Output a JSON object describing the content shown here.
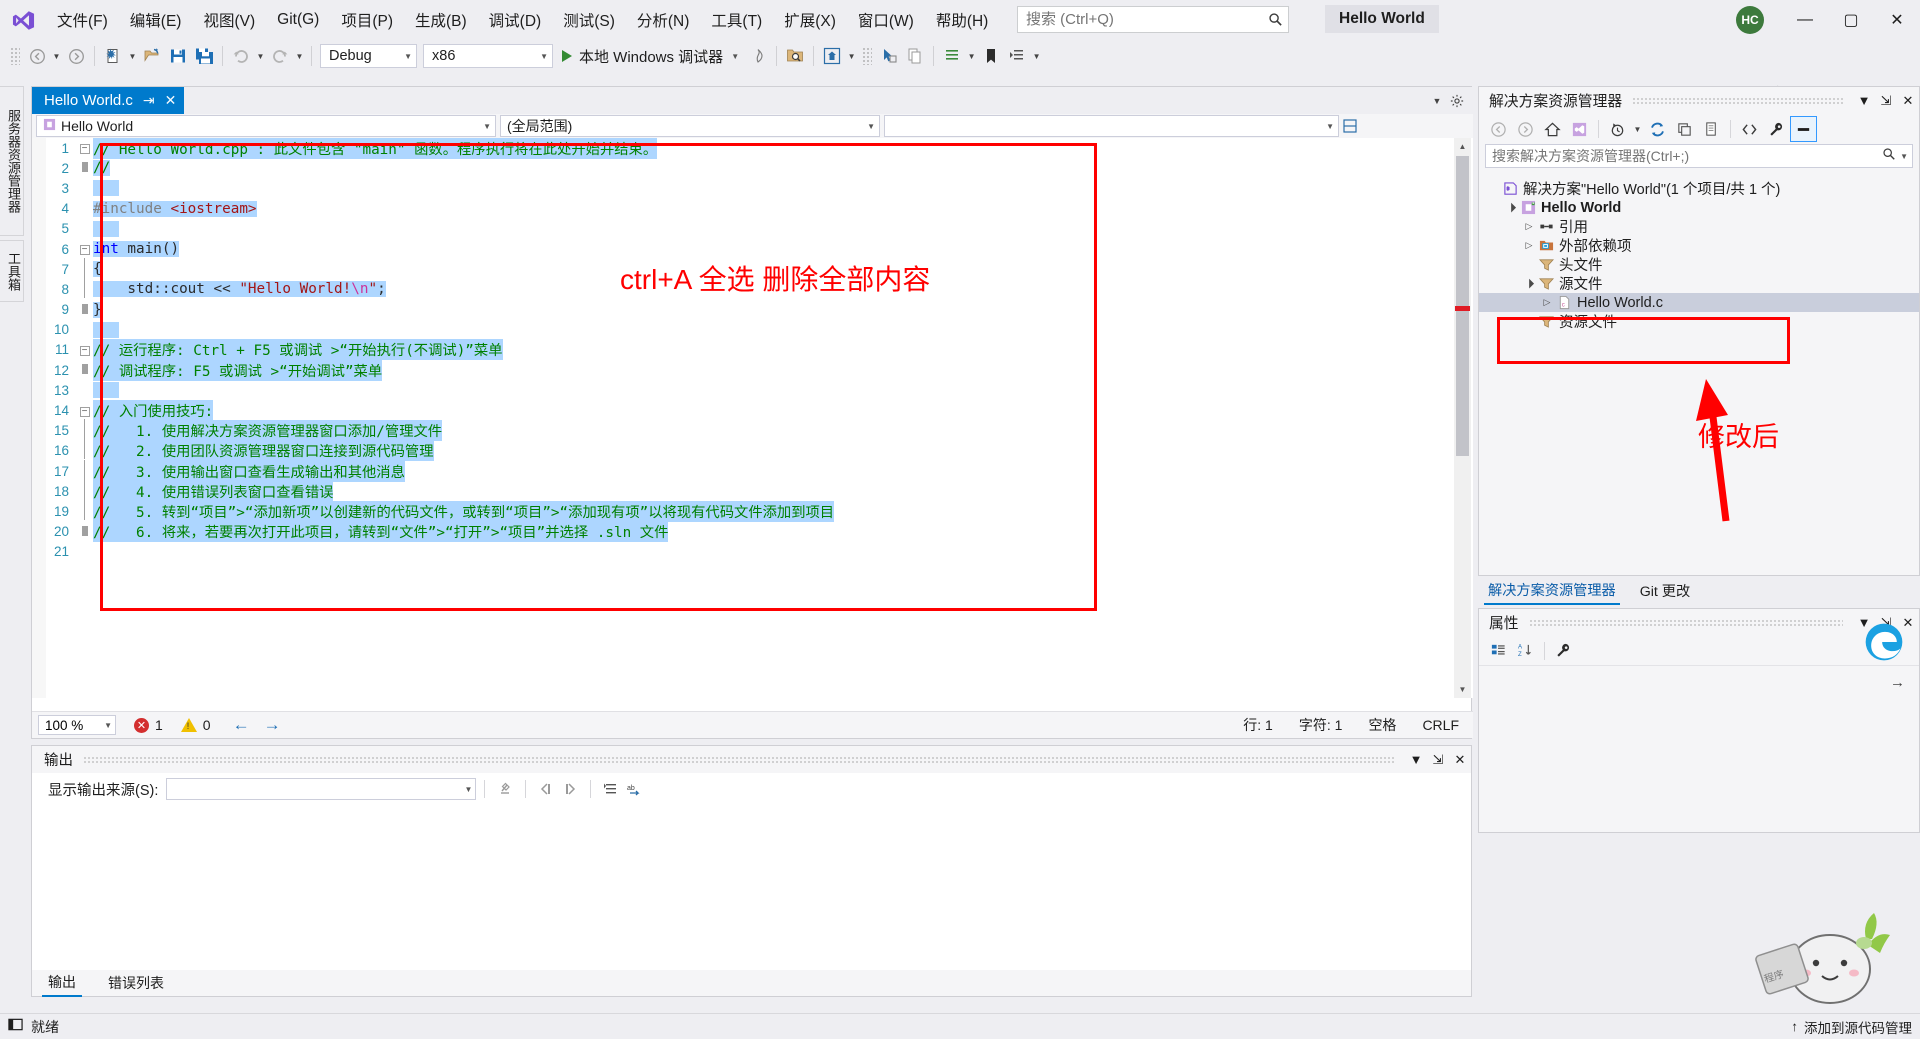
{
  "app": {
    "window_title": "Hello World",
    "solution_name_badge": "Hello World",
    "avatar_initials": "HC"
  },
  "menu": {
    "items": [
      {
        "label": "文件(F)"
      },
      {
        "label": "编辑(E)"
      },
      {
        "label": "视图(V)"
      },
      {
        "label": "Git(G)"
      },
      {
        "label": "项目(P)"
      },
      {
        "label": "生成(B)"
      },
      {
        "label": "调试(D)"
      },
      {
        "label": "测试(S)"
      },
      {
        "label": "分析(N)"
      },
      {
        "label": "工具(T)"
      },
      {
        "label": "扩展(X)"
      },
      {
        "label": "窗口(W)"
      },
      {
        "label": "帮助(H)"
      }
    ]
  },
  "search": {
    "placeholder": "搜索 (Ctrl+Q)",
    "value": ""
  },
  "window_controls": {
    "minimize": "—",
    "maximize": "▢",
    "close": "✕"
  },
  "toolbar": {
    "configuration": "Debug",
    "platform": "x86",
    "run_label": "本地 Windows 调试器",
    "live_share": "Live Share"
  },
  "vertical_tabs": {
    "server_explorer": "服务器资源管理器",
    "toolbox": "工具箱"
  },
  "editor": {
    "tab_label": "Hello World.c",
    "nav_left": "Hello World",
    "nav_middle": "(全局范围)",
    "nav_right": "",
    "zoom": "100 %",
    "error_count": "1",
    "warning_count": "0",
    "status_line": "行: 1",
    "status_col": "字符: 1",
    "status_mode": "空格",
    "status_eol": "CRLF",
    "lines": [
      {
        "n": "1",
        "fold": "minus",
        "text": "// Hello World.cpp : 此文件包含 \"main\" 函数。程序执行将在此处开始并结束。",
        "type": "comment",
        "selected": true
      },
      {
        "n": "2",
        "fold": "end",
        "text": "//",
        "type": "comment",
        "selected": true
      },
      {
        "n": "3",
        "fold": "none",
        "text": "",
        "type": "blank",
        "selected": true
      },
      {
        "n": "4",
        "fold": "none",
        "text": "#include <iostream>",
        "type": "include",
        "selected": true
      },
      {
        "n": "5",
        "fold": "none",
        "text": "",
        "type": "blank",
        "selected": true
      },
      {
        "n": "6",
        "fold": "minus",
        "text": "int main()",
        "type": "func",
        "selected": true
      },
      {
        "n": "7",
        "fold": "bar",
        "text": "{",
        "type": "plain",
        "selected": true
      },
      {
        "n": "8",
        "fold": "bar",
        "text": "    std::cout << \"Hello World!\\n\";",
        "type": "cout",
        "selected": true
      },
      {
        "n": "9",
        "fold": "end",
        "text": "}",
        "type": "plain",
        "selected": true
      },
      {
        "n": "10",
        "fold": "none",
        "text": "",
        "type": "blank",
        "selected": true
      },
      {
        "n": "11",
        "fold": "minus",
        "text": "// 运行程序: Ctrl + F5 或调试 >“开始执行(不调试)”菜单",
        "type": "comment",
        "selected": true
      },
      {
        "n": "12",
        "fold": "end",
        "text": "// 调试程序: F5 或调试 >“开始调试”菜单",
        "type": "comment",
        "selected": true
      },
      {
        "n": "13",
        "fold": "none",
        "text": "",
        "type": "blank",
        "selected": true
      },
      {
        "n": "14",
        "fold": "minus",
        "text": "// 入门使用技巧:",
        "type": "comment",
        "selected": true
      },
      {
        "n": "15",
        "fold": "bar",
        "text": "//   1. 使用解决方案资源管理器窗口添加/管理文件",
        "type": "comment",
        "selected": true
      },
      {
        "n": "16",
        "fold": "bar",
        "text": "//   2. 使用团队资源管理器窗口连接到源代码管理",
        "type": "comment",
        "selected": true
      },
      {
        "n": "17",
        "fold": "bar",
        "text": "//   3. 使用输出窗口查看生成输出和其他消息",
        "type": "comment",
        "selected": true
      },
      {
        "n": "18",
        "fold": "bar",
        "text": "//   4. 使用错误列表窗口查看错误",
        "type": "comment",
        "selected": true
      },
      {
        "n": "19",
        "fold": "bar",
        "text": "//   5. 转到“项目”>“添加新项”以创建新的代码文件，或转到“项目”>“添加现有项”以将现有代码文件添加到项目",
        "type": "comment",
        "selected": true
      },
      {
        "n": "20",
        "fold": "end",
        "text": "//   6. 将来，若要再次打开此项目，请转到“文件”>“打开”>“项目”并选择 .sln 文件",
        "type": "comment",
        "selected": true
      },
      {
        "n": "21",
        "fold": "none",
        "text": "",
        "type": "blank",
        "selected": false
      }
    ]
  },
  "output": {
    "title": "输出",
    "source_label": "显示输出来源(S):",
    "source_value": "",
    "body_text": "",
    "tabs": [
      {
        "label": "输出",
        "active": true
      },
      {
        "label": "错误列表",
        "active": false
      }
    ]
  },
  "solution_explorer": {
    "title": "解决方案资源管理器",
    "search_placeholder": "搜索解决方案资源管理器(Ctrl+;)",
    "tree": [
      {
        "label": "解决方案\"Hello World\"(1 个项目/共 1 个)",
        "indent": 0,
        "expander": "",
        "icon": "solution-icon",
        "bold": false,
        "selected": false
      },
      {
        "label": "Hello World",
        "indent": 1,
        "expander": "▲",
        "icon": "project-icon",
        "bold": true,
        "selected": false
      },
      {
        "label": "引用",
        "indent": 2,
        "expander": "▷",
        "icon": "references-icon",
        "bold": false,
        "selected": false
      },
      {
        "label": "外部依赖项",
        "indent": 2,
        "expander": "▷",
        "icon": "dependencies-icon",
        "bold": false,
        "selected": false
      },
      {
        "label": "头文件",
        "indent": 2,
        "expander": "",
        "icon": "filter-folder-icon",
        "bold": false,
        "selected": false
      },
      {
        "label": "源文件",
        "indent": 2,
        "expander": "▲",
        "icon": "filter-folder-icon",
        "bold": false,
        "selected": false
      },
      {
        "label": "Hello World.c",
        "indent": 3,
        "expander": "▷",
        "icon": "c-file-icon",
        "bold": false,
        "selected": true
      },
      {
        "label": "资源文件",
        "indent": 2,
        "expander": "",
        "icon": "filter-folder-icon",
        "bold": false,
        "selected": false
      }
    ],
    "tabs": [
      {
        "label": "解决方案资源管理器",
        "active": true
      },
      {
        "label": "Git 更改",
        "active": false
      }
    ]
  },
  "properties": {
    "title": "属性"
  },
  "statusbar": {
    "ready": "就绪",
    "right_text": "添加到源代码管理"
  },
  "annotations": {
    "code_note": "ctrl+A 全选 删除全部内容",
    "solution_note": "修改后",
    "accent_red": "#ff0000"
  }
}
